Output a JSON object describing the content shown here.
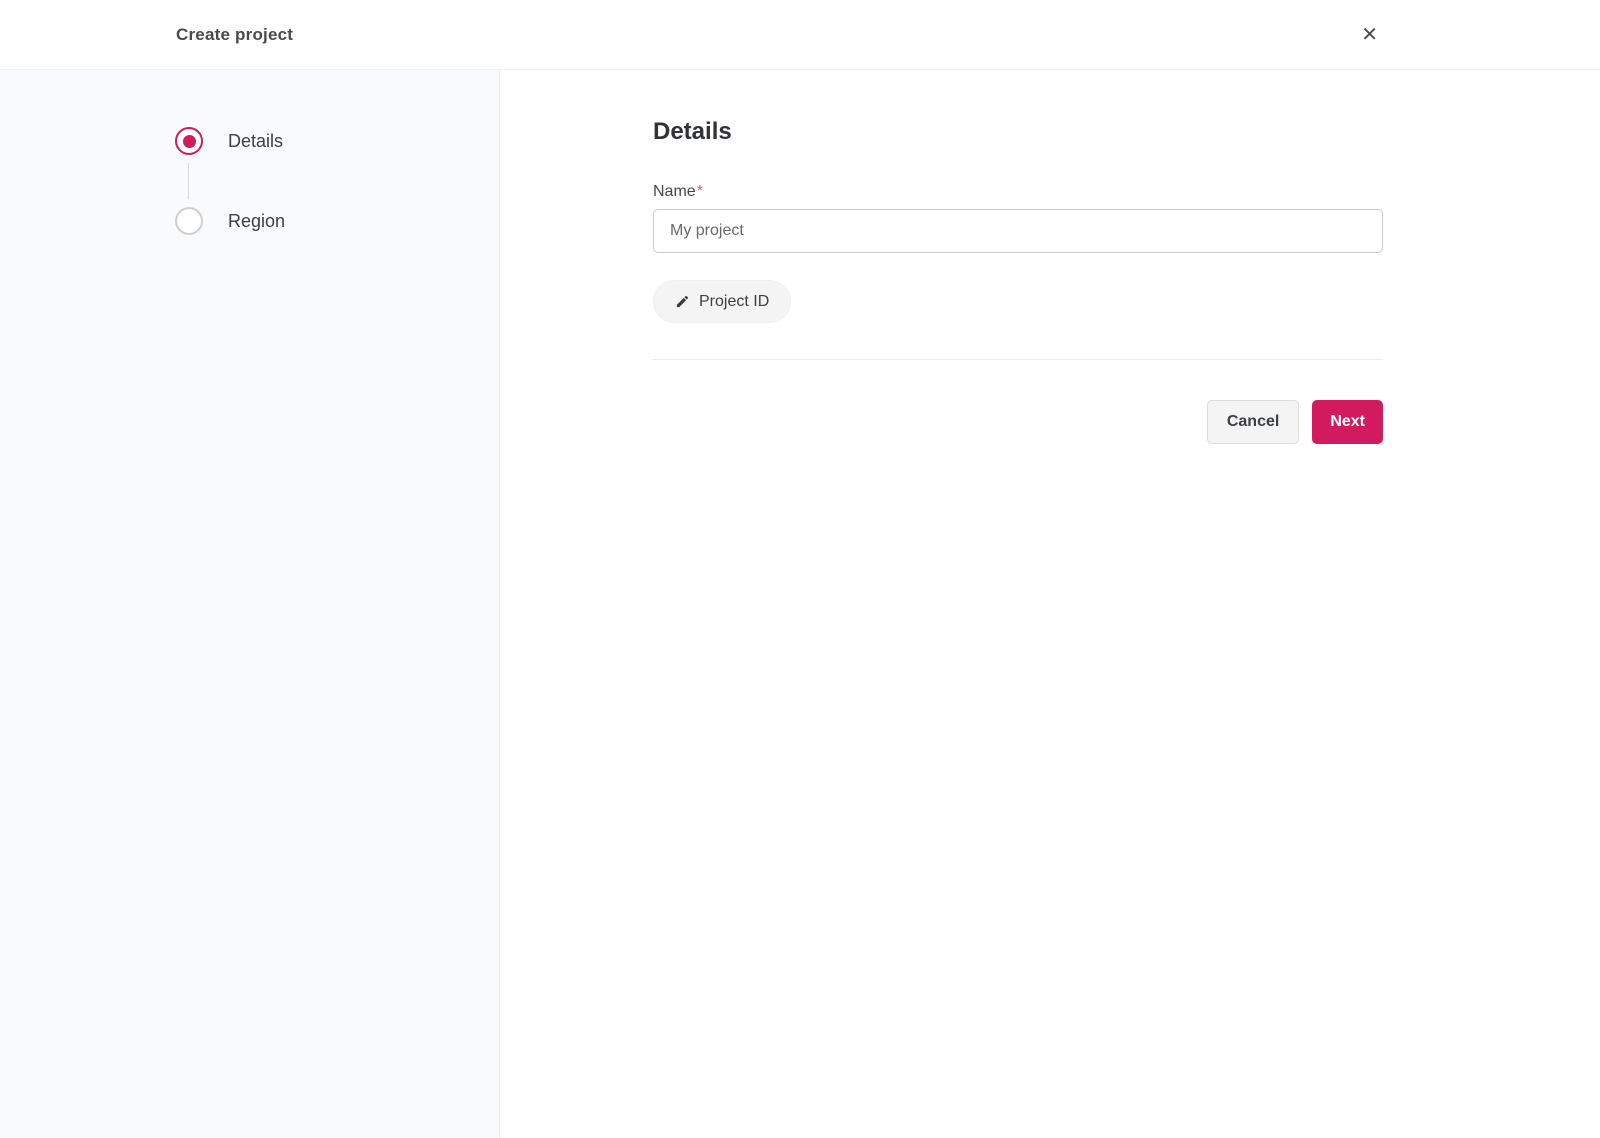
{
  "header": {
    "title": "Create project",
    "close_icon": "✕"
  },
  "stepper": {
    "steps": [
      {
        "label": "Details",
        "state": "active"
      },
      {
        "label": "Region",
        "state": "inactive"
      }
    ]
  },
  "main": {
    "heading": "Details",
    "form": {
      "name_label": "Name",
      "required_marker": "*",
      "name_placeholder": "My project",
      "name_value": "",
      "project_id_button": "Project ID",
      "project_id_icon": "pencil-icon"
    },
    "actions": {
      "cancel_label": "Cancel",
      "next_label": "Next"
    }
  },
  "colors": {
    "accent": "#d21a5e",
    "required": "#e45757",
    "sidebar_bg": "#f9fafb"
  }
}
